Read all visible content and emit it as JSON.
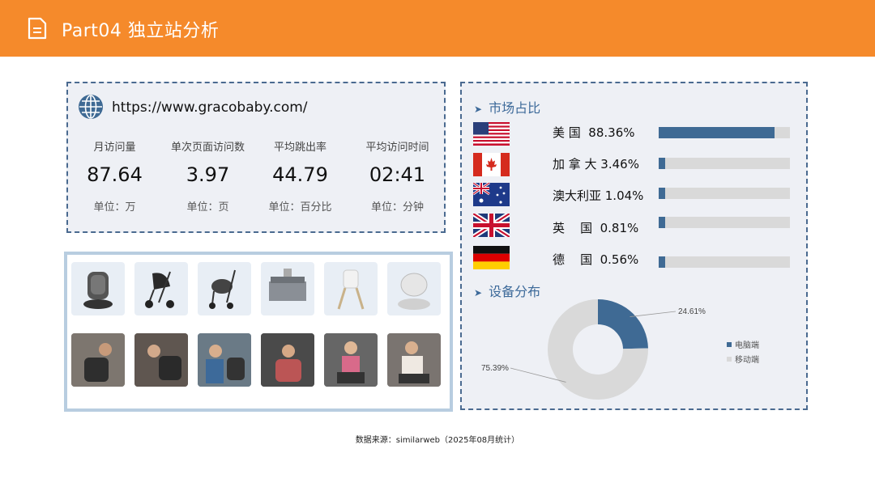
{
  "header": {
    "title": "Part04 独立站分析"
  },
  "site": {
    "url": "https://www.gracobaby.com/",
    "metrics": [
      {
        "label": "月访问量",
        "value": "87.64",
        "unit": "单位：万"
      },
      {
        "label": "单次页面访问数",
        "value": "3.97",
        "unit": "单位：页"
      },
      {
        "label": "平均跳出率",
        "value": "44.79",
        "unit": "单位：百分比"
      },
      {
        "label": "平均访问时间",
        "value": "02:41",
        "unit": "单位：分钟"
      }
    ]
  },
  "market": {
    "title": "市场占比",
    "rows": [
      {
        "country": "美 国  88.36%",
        "share": 0.8836,
        "flag": "us-flag"
      },
      {
        "country": "加 拿 大 3.46%",
        "share": 0.0346,
        "flag": "canada-flag"
      },
      {
        "country": "澳大利亚 1.04%",
        "share": 0.0104,
        "flag": "australia-flag"
      },
      {
        "country": "英    国  0.81%",
        "share": 0.0081,
        "flag": "uk-flag"
      },
      {
        "country": "德    国  0.56%",
        "share": 0.0056,
        "flag": "germany-flag"
      }
    ],
    "bar_color": "#3f6a94",
    "track_color": "#d9d9d9"
  },
  "device": {
    "title": "设备分布",
    "chart_data": {
      "type": "pie",
      "series": [
        {
          "name": "电脑端",
          "value": 24.61,
          "label": "24.61%",
          "color": "#3f6a94"
        },
        {
          "name": "移动端",
          "value": 75.39,
          "label": "75.39%",
          "color": "#d9d9d9"
        }
      ],
      "legend": "right"
    }
  },
  "source": "数据来源：similarweb（2025年08月统计）"
}
